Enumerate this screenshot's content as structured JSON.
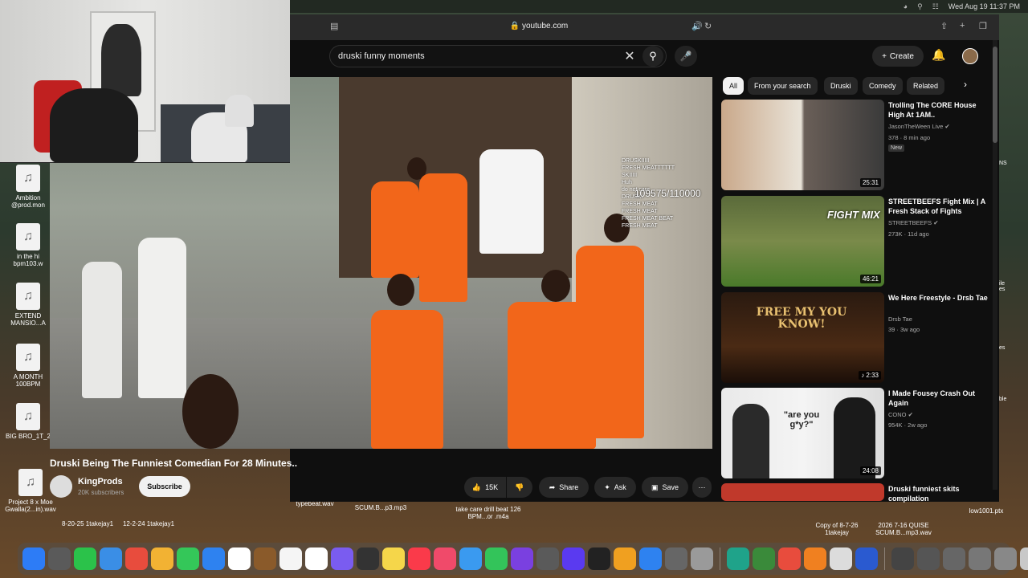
{
  "menubar": {
    "clock": "Wed Aug 19  11:37 PM"
  },
  "browser": {
    "url": "youtube.com"
  },
  "search": {
    "query": "druski funny moments"
  },
  "header": {
    "create_label": "Create"
  },
  "chips": [
    "All",
    "From your search",
    "Druski",
    "Comedy",
    "Related"
  ],
  "player": {
    "viewer_count": "109575/110000",
    "chat_lines": [
      "DRUSKIIIII",
      "FRESH MEATTTTTT",
      "SKIIIII",
      "Huh",
      "do not care",
      "DRUSKI",
      "FRESH MEAT",
      "FRESH MEAT",
      "FRESH MEAT BEAT",
      "FRESH MEAT"
    ]
  },
  "video": {
    "title": "Druski Being The Funniest Comedian For 28 Minutes..",
    "channel": "KingProds",
    "subscribers": "20K subscribers",
    "subscribe_label": "Subscribe",
    "likes": "15K",
    "share_label": "Share",
    "ask_label": "Ask",
    "save_label": "Save"
  },
  "recommendations": [
    {
      "title": "Trolling The CORE House High At 1AM..",
      "channel": "JasonTheWeen Live",
      "meta": "378 · 8 min ago",
      "badge": "New",
      "duration": "25:31"
    },
    {
      "title": "STREETBEEFS Fight Mix | A Fresh Stack of Fights",
      "channel": "STREETBEEFS",
      "meta": "273K · 11d ago",
      "badge": "",
      "duration": "46:21",
      "thumb_text": "FIGHT MIX"
    },
    {
      "title": "We Here Freestyle - Drsb Tae",
      "channel": "Drsb Tae",
      "meta": "39 · 3w ago",
      "badge": "",
      "duration": "2:33",
      "thumb_text": "FREE MY YOU KNOW!"
    },
    {
      "title": "I Made Fousey Crash Out Again",
      "channel": "CONO",
      "meta": "954K · 2w ago",
      "badge": "",
      "duration": "24:08",
      "thumb_text": "\"are you g*y?\""
    },
    {
      "title": "Druski funniest skits compilation",
      "channel": "",
      "meta": "",
      "badge": "",
      "duration": ""
    }
  ],
  "desktop": {
    "left_icons": [
      "Ambition @prod.mon",
      "in the hi bpm103.w",
      "EXTEND MANSIO...A",
      "A MONTH 100BPM",
      "BIG BRO_1T_2",
      "Project 8 x Moe Gwalla(2...in).wav"
    ],
    "bottom_files": [
      "8-20-25 1takejay1",
      "12-2-24 1takejay1",
      "typebeat.wav",
      "SCUM.B...p3.mp3",
      "take care drill beat 126 BPM...or .m4a",
      "Copy of 8-7-26 1takejay",
      "2026 7-16 QUISE SCUM.B...mp3.wav",
      "low1001.ptx"
    ],
    "right_fragments": [
      "NS",
      "ile es",
      "es",
      "ble"
    ]
  },
  "dock": {
    "colors": [
      "#2d7cf6",
      "#5a5a5a",
      "#2bc24a",
      "#3a8ee6",
      "#e84c3d",
      "#f2b233",
      "#34c759",
      "#2e82f0",
      "#ffffff",
      "#8a5a2a",
      "#f5f5f5",
      "#ffffff",
      "#7a5cf0",
      "#333333",
      "#f5d64a",
      "#fa3a4a",
      "#f04a6a",
      "#3a9af0",
      "#33c45a",
      "#7a40e0",
      "#5a5a5a",
      "#5a3af0",
      "#222222",
      "#f0a020",
      "#2e82f0",
      "#666666",
      "#9a9a9a",
      "#1fa38a",
      "#3a8a3a",
      "#e84c3d",
      "#f08020",
      "#dcdcdc",
      "#2a5ad0",
      "#444444",
      "#555555",
      "#666666",
      "#777777",
      "#888888",
      "#c8c8c8"
    ]
  }
}
